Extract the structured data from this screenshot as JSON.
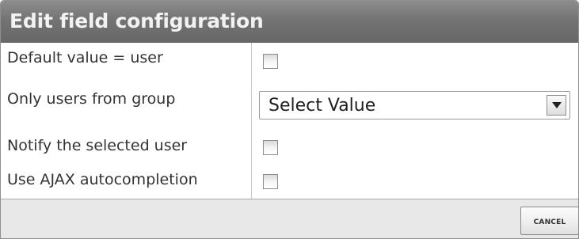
{
  "dialog": {
    "title": "Edit field configuration"
  },
  "fields": {
    "default_value": {
      "label": "Default value = user",
      "checked": false
    },
    "group_filter": {
      "label": "Only users from group",
      "selected": "Select Value"
    },
    "notify": {
      "label": "Notify the selected user",
      "checked": false
    },
    "ajax": {
      "label": "Use AJAX autocompletion",
      "checked": false
    }
  },
  "footer": {
    "cancel_label": "Cancel"
  },
  "icons": {
    "dropdown": "chevron-down-icon"
  },
  "colors": {
    "header_bg": "#767676",
    "header_text": "#f2f2f2",
    "footer_bg": "#e8e8e8",
    "label_text": "#333333"
  }
}
